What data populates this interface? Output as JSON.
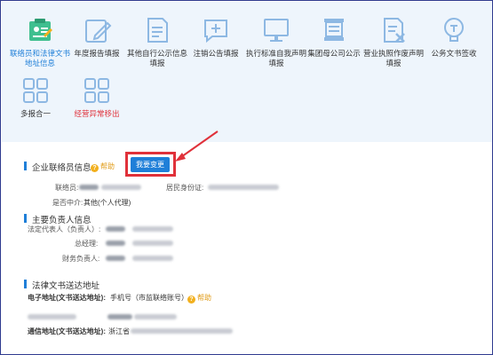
{
  "tools": [
    {
      "label": "联络员和法律文书地址信息",
      "icon": "contact-card-icon",
      "state": "active"
    },
    {
      "label": "年度报告填报",
      "icon": "edit-icon",
      "state": "normal"
    },
    {
      "label": "其他自行公示信息填报",
      "icon": "document-icon",
      "state": "normal"
    },
    {
      "label": "注销公告填报",
      "icon": "message-add-icon",
      "state": "normal"
    },
    {
      "label": "执行标准自我声明填报",
      "icon": "monitor-icon",
      "state": "normal"
    },
    {
      "label": "集团母公司公示",
      "icon": "banner-icon",
      "state": "normal"
    },
    {
      "label": "营业执照作废声明填报",
      "icon": "document-cancel-icon",
      "state": "normal"
    },
    {
      "label": "公务文书签收",
      "icon": "lightbulb-icon",
      "state": "normal"
    },
    {
      "label": "多报合一",
      "icon": "grid-icon",
      "state": "normal"
    },
    {
      "label": "经营异常移出",
      "icon": "grid-icon",
      "state": "red"
    }
  ],
  "liaison": {
    "title": "企业联络员信息",
    "help": "帮助",
    "change_button": "我要变更",
    "contact_label": "联络员:",
    "id_label": "居民身份证:",
    "intermediary_label": "是否中介:",
    "intermediary_value": "其他(个人代理)"
  },
  "principals": {
    "title": "主要负责人信息",
    "legal_rep_label": "法定代表人（负责人）:",
    "manager_label": "总经理:",
    "finance_label": "财务负责人:"
  },
  "legal_docs": {
    "title": "法律文书送达地址",
    "email_label": "电子地址(文书送达地址):",
    "email_value": "手机号（市监联络账号）",
    "help": "帮助",
    "postal_label": "通信地址(文书送达地址):",
    "postal_prefix": "浙江省"
  },
  "colors": {
    "accent": "#1f7fd8",
    "highlight": "#e0313a",
    "help": "#e09b16",
    "toolbar_bg": "#eef5fc"
  }
}
